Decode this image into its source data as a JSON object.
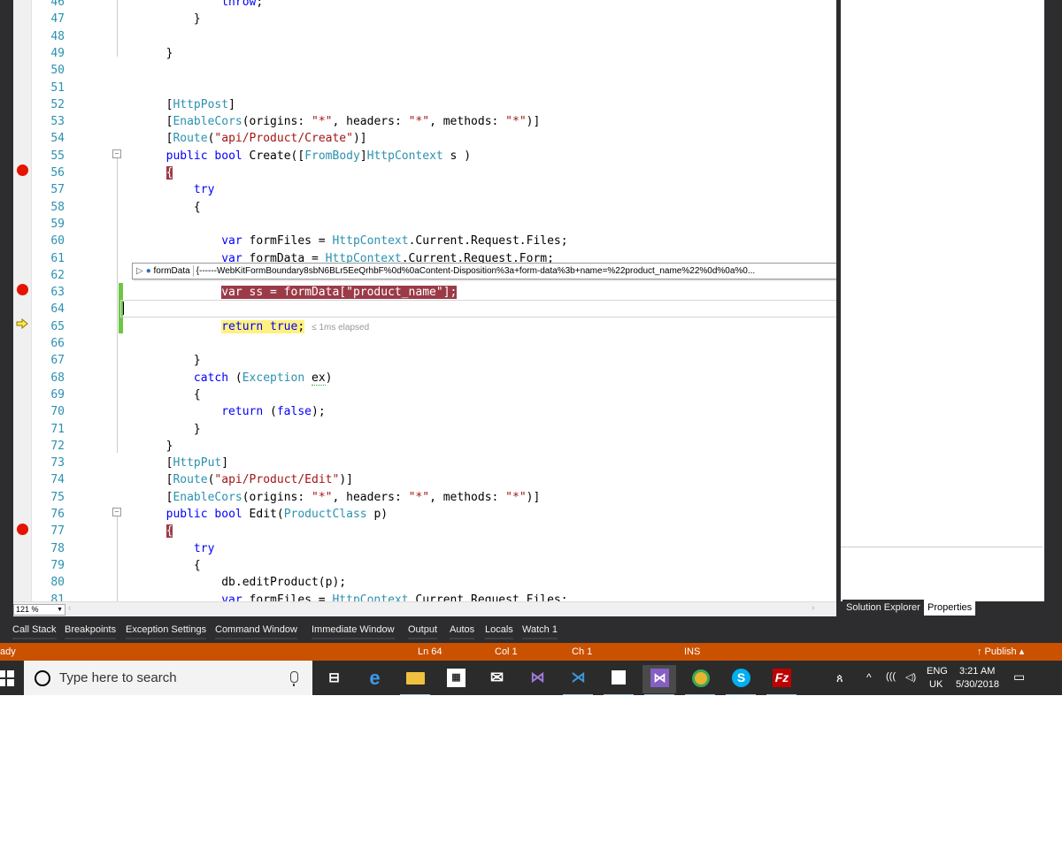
{
  "editor": {
    "lines": [
      {
        "n": "46",
        "t": "                throw;"
      },
      {
        "n": "47",
        "t": "            }"
      },
      {
        "n": "48",
        "t": ""
      },
      {
        "n": "49",
        "t": "        }"
      },
      {
        "n": "50",
        "t": ""
      },
      {
        "n": "51",
        "t": ""
      },
      {
        "n": "52",
        "t": "        [HttpPost]"
      },
      {
        "n": "53",
        "t": "        [EnableCors(origins: \"*\", headers: \"*\", methods: \"*\")]"
      },
      {
        "n": "54",
        "t": "        [Route(\"api/Product/Create\")]"
      },
      {
        "n": "55",
        "t": "        public bool Create([FromBody]HttpContext s )"
      },
      {
        "n": "56",
        "t": "        {"
      },
      {
        "n": "57",
        "t": "            try"
      },
      {
        "n": "58",
        "t": "            {"
      },
      {
        "n": "59",
        "t": ""
      },
      {
        "n": "60",
        "t": "                var formFiles = HttpContext.Current.Request.Files;"
      },
      {
        "n": "61",
        "t": "                var formData = HttpContext.Current.Request.Form;"
      },
      {
        "n": "62",
        "t": ""
      },
      {
        "n": "63",
        "t": "                var ss = formData[\"product_name\"];"
      },
      {
        "n": "64",
        "t": ""
      },
      {
        "n": "65",
        "t": "                return true;"
      },
      {
        "n": "66",
        "t": ""
      },
      {
        "n": "67",
        "t": "            }"
      },
      {
        "n": "68",
        "t": "            catch (Exception ex)"
      },
      {
        "n": "69",
        "t": "            {"
      },
      {
        "n": "70",
        "t": "                return (false);"
      },
      {
        "n": "71",
        "t": "            }"
      },
      {
        "n": "72",
        "t": "        }"
      },
      {
        "n": "73",
        "t": "        [HttpPut]"
      },
      {
        "n": "74",
        "t": "        [Route(\"api/Product/Edit\")]"
      },
      {
        "n": "75",
        "t": "        [EnableCors(origins: \"*\", headers: \"*\", methods: \"*\")]"
      },
      {
        "n": "76",
        "t": "        public bool Edit(ProductClass p)"
      },
      {
        "n": "77",
        "t": "        {"
      },
      {
        "n": "78",
        "t": "            try"
      },
      {
        "n": "79",
        "t": "            {"
      },
      {
        "n": "80",
        "t": "                db.editProduct(p);"
      },
      {
        "n": "81",
        "t": "                var formFiles = HttpContext.Current.Request.Files;"
      }
    ],
    "elapsed": "≤ 1ms elapsed",
    "zoom": "121 %"
  },
  "datatip": {
    "name": "formData",
    "value": "{------WebKitFormBoundary8sbN6BLr5EeQrhbF%0d%0aContent-Disposition%3a+form-data%3b+name=%22product_name%22%0d%0a%0..."
  },
  "right_tabs": {
    "solution_explorer": "Solution Explorer",
    "properties": "Properties"
  },
  "debug_tabs": [
    "Call Stack",
    "Breakpoints",
    "Exception Settings",
    "Command Window",
    "Immediate Window",
    "Output",
    "Autos",
    "Locals",
    "Watch 1"
  ],
  "status": {
    "state": "ady",
    "ln": "Ln 64",
    "col": "Col 1",
    "ch": "Ch 1",
    "ins": "INS",
    "publish": "↑  Publish ▴"
  },
  "taskbar": {
    "search_placeholder": "Type here to search",
    "lang": "ENG",
    "region": "UK",
    "time": "3:21 AM",
    "date": "5/30/2018"
  },
  "colors": {
    "breakpoint": "#e51400",
    "status_bar": "#ca5100",
    "ide_dark": "#2d2d30",
    "current_statement": "#fff181",
    "breakpoint_line": "#9b3b48"
  }
}
